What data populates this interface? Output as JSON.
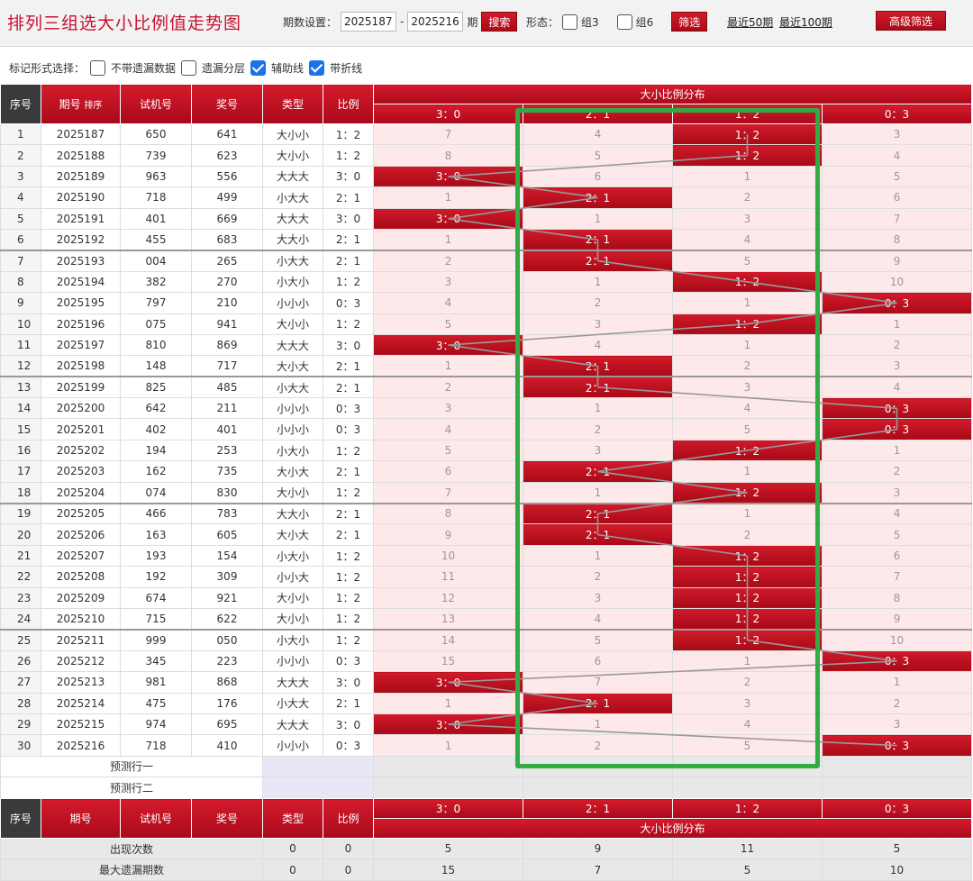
{
  "title": "排列三组选大小比例值走势图",
  "controls": {
    "period_label": "期数设置：",
    "from": "2025187",
    "dash": "-",
    "to": "2025216",
    "period_unit": "期",
    "search": "搜索",
    "form_label": "形态：",
    "g3": "组3",
    "g6": "组6",
    "filter": "筛选",
    "last50": "最近50期",
    "last100": "最近100期",
    "advanced": "高级筛选"
  },
  "markbar": {
    "label": "标记形式选择：",
    "opt1": "不带遗漏数据",
    "opt2": "遗漏分层",
    "opt3": "辅助线",
    "opt4": "带折线"
  },
  "headers": {
    "seq": "序号",
    "period": "期号",
    "sort": "排序",
    "trial": "试机号",
    "prize": "奖号",
    "type": "类型",
    "ratio": "比例",
    "dist": "大小比例分布",
    "cols": [
      "3：0",
      "2：1",
      "1：2",
      "0：3"
    ]
  },
  "rows": [
    {
      "seq": "1",
      "period": "2025187",
      "trial": "650",
      "prize": "641",
      "type": "大小小",
      "ratio": "1：2",
      "d": [
        "7",
        "4",
        "1：2",
        "3"
      ],
      "hit": 2
    },
    {
      "seq": "2",
      "period": "2025188",
      "trial": "739",
      "prize": "623",
      "type": "大小小",
      "ratio": "1：2",
      "d": [
        "8",
        "5",
        "1：2",
        "4"
      ],
      "hit": 2
    },
    {
      "seq": "3",
      "period": "2025189",
      "trial": "963",
      "prize": "556",
      "type": "大大大",
      "ratio": "3：0",
      "d": [
        "3：0",
        "6",
        "1",
        "5"
      ],
      "hit": 0
    },
    {
      "seq": "4",
      "period": "2025190",
      "trial": "718",
      "prize": "499",
      "type": "小大大",
      "ratio": "2：1",
      "d": [
        "1",
        "2：1",
        "2",
        "6"
      ],
      "hit": 1
    },
    {
      "seq": "5",
      "period": "2025191",
      "trial": "401",
      "prize": "669",
      "type": "大大大",
      "ratio": "3：0",
      "d": [
        "3：0",
        "1",
        "3",
        "7"
      ],
      "hit": 0
    },
    {
      "seq": "6",
      "period": "2025192",
      "trial": "455",
      "prize": "683",
      "type": "大大小",
      "ratio": "2：1",
      "d": [
        "1",
        "2：1",
        "4",
        "8"
      ],
      "hit": 1
    },
    {
      "seq": "7",
      "period": "2025193",
      "trial": "004",
      "prize": "265",
      "type": "小大大",
      "ratio": "2：1",
      "d": [
        "2",
        "2：1",
        "5",
        "9"
      ],
      "hit": 1
    },
    {
      "seq": "8",
      "period": "2025194",
      "trial": "382",
      "prize": "270",
      "type": "小大小",
      "ratio": "1：2",
      "d": [
        "3",
        "1",
        "1：2",
        "10"
      ],
      "hit": 2
    },
    {
      "seq": "9",
      "period": "2025195",
      "trial": "797",
      "prize": "210",
      "type": "小小小",
      "ratio": "0：3",
      "d": [
        "4",
        "2",
        "1",
        "0：3"
      ],
      "hit": 3
    },
    {
      "seq": "10",
      "period": "2025196",
      "trial": "075",
      "prize": "941",
      "type": "大小小",
      "ratio": "1：2",
      "d": [
        "5",
        "3",
        "1：2",
        "1"
      ],
      "hit": 2
    },
    {
      "seq": "11",
      "period": "2025197",
      "trial": "810",
      "prize": "869",
      "type": "大大大",
      "ratio": "3：0",
      "d": [
        "3：0",
        "4",
        "1",
        "2"
      ],
      "hit": 0
    },
    {
      "seq": "12",
      "period": "2025198",
      "trial": "148",
      "prize": "717",
      "type": "大小大",
      "ratio": "2：1",
      "d": [
        "1",
        "2：1",
        "2",
        "3"
      ],
      "hit": 1
    },
    {
      "seq": "13",
      "period": "2025199",
      "trial": "825",
      "prize": "485",
      "type": "小大大",
      "ratio": "2：1",
      "d": [
        "2",
        "2：1",
        "3",
        "4"
      ],
      "hit": 1
    },
    {
      "seq": "14",
      "period": "2025200",
      "trial": "642",
      "prize": "211",
      "type": "小小小",
      "ratio": "0：3",
      "d": [
        "3",
        "1",
        "4",
        "0：3"
      ],
      "hit": 3
    },
    {
      "seq": "15",
      "period": "2025201",
      "trial": "402",
      "prize": "401",
      "type": "小小小",
      "ratio": "0：3",
      "d": [
        "4",
        "2",
        "5",
        "0：3"
      ],
      "hit": 3
    },
    {
      "seq": "16",
      "period": "2025202",
      "trial": "194",
      "prize": "253",
      "type": "小大小",
      "ratio": "1：2",
      "d": [
        "5",
        "3",
        "1：2",
        "1"
      ],
      "hit": 2
    },
    {
      "seq": "17",
      "period": "2025203",
      "trial": "162",
      "prize": "735",
      "type": "大小大",
      "ratio": "2：1",
      "d": [
        "6",
        "2：1",
        "1",
        "2"
      ],
      "hit": 1
    },
    {
      "seq": "18",
      "period": "2025204",
      "trial": "074",
      "prize": "830",
      "type": "大小小",
      "ratio": "1：2",
      "d": [
        "7",
        "1",
        "1：2",
        "3"
      ],
      "hit": 2
    },
    {
      "seq": "19",
      "period": "2025205",
      "trial": "466",
      "prize": "783",
      "type": "大大小",
      "ratio": "2：1",
      "d": [
        "8",
        "2：1",
        "1",
        "4"
      ],
      "hit": 1
    },
    {
      "seq": "20",
      "period": "2025206",
      "trial": "163",
      "prize": "605",
      "type": "大小大",
      "ratio": "2：1",
      "d": [
        "9",
        "2：1",
        "2",
        "5"
      ],
      "hit": 1
    },
    {
      "seq": "21",
      "period": "2025207",
      "trial": "193",
      "prize": "154",
      "type": "小大小",
      "ratio": "1：2",
      "d": [
        "10",
        "1",
        "1：2",
        "6"
      ],
      "hit": 2
    },
    {
      "seq": "22",
      "period": "2025208",
      "trial": "192",
      "prize": "309",
      "type": "小小大",
      "ratio": "1：2",
      "d": [
        "11",
        "2",
        "1：2",
        "7"
      ],
      "hit": 2
    },
    {
      "seq": "23",
      "period": "2025209",
      "trial": "674",
      "prize": "921",
      "type": "大小小",
      "ratio": "1：2",
      "d": [
        "12",
        "3",
        "1：2",
        "8"
      ],
      "hit": 2
    },
    {
      "seq": "24",
      "period": "2025210",
      "trial": "715",
      "prize": "622",
      "type": "大小小",
      "ratio": "1：2",
      "d": [
        "13",
        "4",
        "1：2",
        "9"
      ],
      "hit": 2
    },
    {
      "seq": "25",
      "period": "2025211",
      "trial": "999",
      "prize": "050",
      "type": "小大小",
      "ratio": "1：2",
      "d": [
        "14",
        "5",
        "1：2",
        "10"
      ],
      "hit": 2
    },
    {
      "seq": "26",
      "period": "2025212",
      "trial": "345",
      "prize": "223",
      "type": "小小小",
      "ratio": "0：3",
      "d": [
        "15",
        "6",
        "1",
        "0：3"
      ],
      "hit": 3
    },
    {
      "seq": "27",
      "period": "2025213",
      "trial": "981",
      "prize": "868",
      "type": "大大大",
      "ratio": "3：0",
      "d": [
        "3：0",
        "7",
        "2",
        "1"
      ],
      "hit": 0
    },
    {
      "seq": "28",
      "period": "2025214",
      "trial": "475",
      "prize": "176",
      "type": "小大大",
      "ratio": "2：1",
      "d": [
        "1",
        "2：1",
        "3",
        "2"
      ],
      "hit": 1
    },
    {
      "seq": "29",
      "period": "2025215",
      "trial": "974",
      "prize": "695",
      "type": "大大大",
      "ratio": "3：0",
      "d": [
        "3：0",
        "1",
        "4",
        "3"
      ],
      "hit": 0
    },
    {
      "seq": "30",
      "period": "2025216",
      "trial": "718",
      "prize": "410",
      "type": "小小小",
      "ratio": "0：3",
      "d": [
        "1",
        "2",
        "5",
        "0：3"
      ],
      "hit": 3
    }
  ],
  "predict": {
    "row1": "预测行一",
    "row2": "预测行二"
  },
  "stats": [
    {
      "label": "出现次数",
      "type": "0",
      "ratio": "0",
      "v": [
        "5",
        "9",
        "11",
        "5"
      ]
    },
    {
      "label": "最大遗漏期数",
      "type": "0",
      "ratio": "0",
      "v": [
        "15",
        "7",
        "5",
        "10"
      ]
    }
  ],
  "colors": {
    "accent": "#c8102e",
    "highlight": "#31ab44",
    "line": "#999999"
  }
}
